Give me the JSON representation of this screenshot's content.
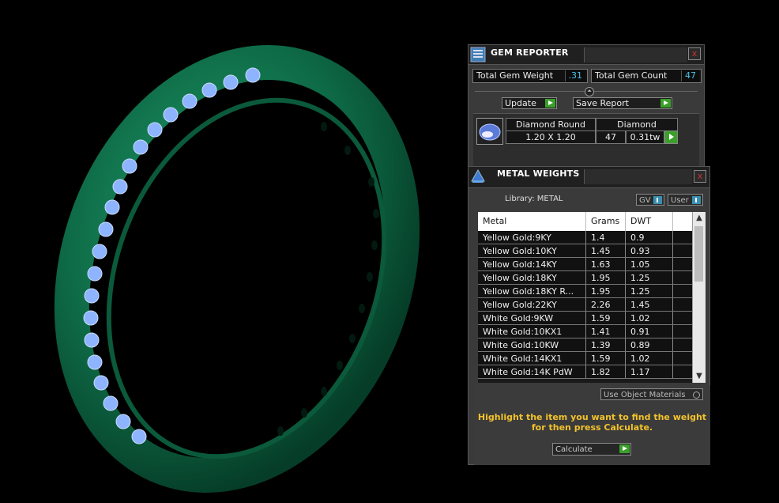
{
  "gem_reporter": {
    "title": "GEM REPORTER",
    "close": "x",
    "total_gem_weight_label": "Total Gem Weight",
    "total_gem_weight_value": ".31",
    "total_gem_count_label": "Total Gem Count",
    "total_gem_count_value": "47",
    "update_label": "Update",
    "save_report_label": "Save Report",
    "gem": {
      "shape": "Diamond Round",
      "type": "Diamond",
      "size": "1.20 X 1.20",
      "count": "47",
      "weight": "0.31tw"
    }
  },
  "metal_weights": {
    "title": "METAL WEIGHTS",
    "close": "x",
    "library_label": "Library: METAL",
    "gv_label": "GV",
    "user_label": "User",
    "columns": [
      "Metal",
      "Grams",
      "DWT"
    ],
    "rows": [
      [
        "Yellow Gold:9KY",
        "1.4",
        "0.9"
      ],
      [
        "Yellow Gold:10KY",
        "1.45",
        "0.93"
      ],
      [
        "Yellow Gold:14KY",
        "1.63",
        "1.05"
      ],
      [
        "Yellow Gold:18KY",
        "1.95",
        "1.25"
      ],
      [
        "Yellow Gold:18KY R...",
        "1.95",
        "1.25"
      ],
      [
        "Yellow Gold:22KY",
        "2.26",
        "1.45"
      ],
      [
        "White Gold:9KW",
        "1.59",
        "1.02"
      ],
      [
        "White Gold:10KX1",
        "1.41",
        "0.91"
      ],
      [
        "White Gold:10KW",
        "1.39",
        "0.89"
      ],
      [
        "White Gold:14KX1",
        "1.59",
        "1.02"
      ],
      [
        "White Gold:14K PdW",
        "1.82",
        "1.17"
      ]
    ],
    "use_object_materials_label": "Use Object Materials",
    "hint_line1": "Highlight the item you want to find the weight",
    "hint_line2": "for then press Calculate.",
    "calculate_label": "Calculate"
  },
  "colors": {
    "ring_green": "#0e6b47",
    "gem_blue": "#8fb4ff",
    "accent_green": "#3aa02a",
    "hint_yellow": "#f2c22b",
    "value_cyan": "#4ac3e6"
  }
}
